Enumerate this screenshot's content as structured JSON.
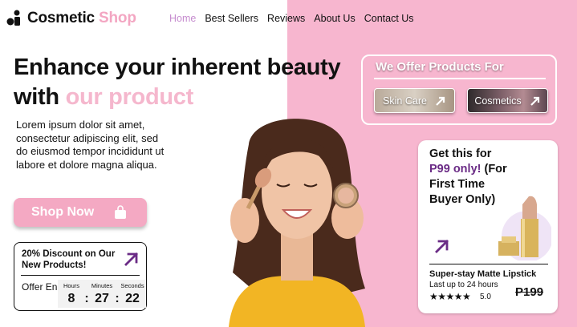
{
  "brand": {
    "name": "Cosmetic",
    "accent": "Shop"
  },
  "nav": [
    "Home",
    "Best Sellers",
    "Reviews",
    "About Us",
    "Contact Us"
  ],
  "hero": {
    "title_line1": "Enhance your inherent beauty",
    "title_with": "with",
    "title_accent": "our product",
    "description": "Lorem ipsum dolor sit amet, consectetur adipiscing elit, sed do eiusmod tempor incididunt ut labore et dolore magna aliqua.",
    "cta": "Shop Now"
  },
  "discount": {
    "title": "20% Discount on Our New Products!",
    "offer_ends": "Offer Ends In",
    "labels": {
      "hours": "Hours",
      "minutes": "Minutes",
      "seconds": "Seconds"
    },
    "hours": "8",
    "minutes": "27",
    "seconds": "22",
    "sep": ":"
  },
  "offer": {
    "title": "We Offer Products For",
    "categories": [
      "Skin Care",
      "Cosmetics"
    ]
  },
  "product": {
    "head_line1": "Get this for",
    "price_text": "P99 only!",
    "head_rest": "(For First Time Buyer Only)",
    "name": "Super-stay Matte Lipstick",
    "subtitle": "Last up to 24 hours",
    "stars": "★★★★★",
    "rating": "5.0",
    "old_price": "P199"
  },
  "colors": {
    "pink": "#f7b6cf",
    "accent_pink": "#f5b7cd",
    "purple": "#6b2c86",
    "nav_active": "#c68ccf"
  }
}
